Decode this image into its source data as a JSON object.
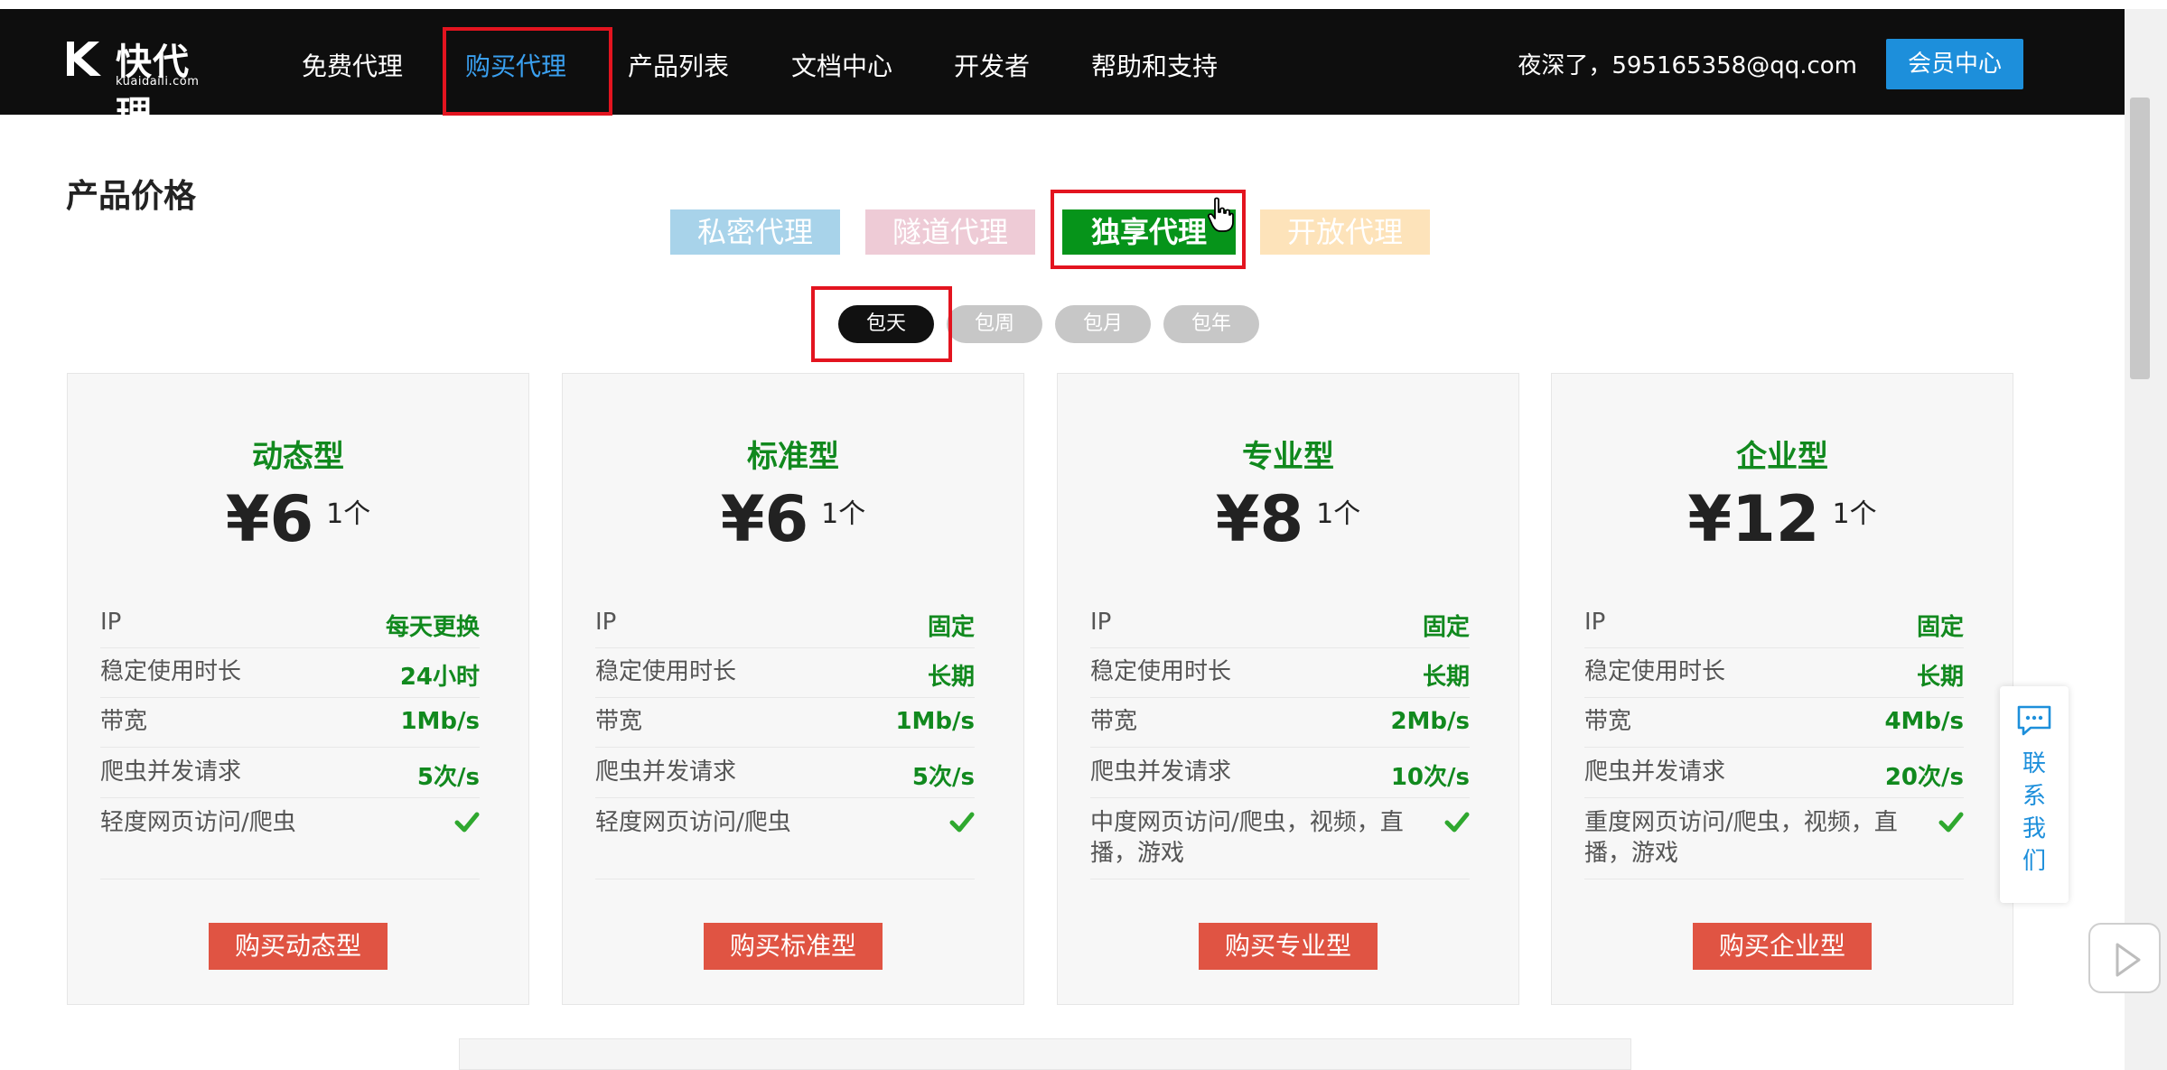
{
  "navbar": {
    "logo_text": "快代理",
    "logo_sub": "kuaidaili.com",
    "items": [
      {
        "label": "免费代理"
      },
      {
        "label": "购买代理"
      },
      {
        "label": "产品列表"
      },
      {
        "label": "文档中心"
      },
      {
        "label": "开发者"
      },
      {
        "label": "帮助和支持"
      }
    ],
    "active_item": "购买代理",
    "greeting": "夜深了，595165358@qq.com",
    "member_button": "会员中心"
  },
  "section_title": "产品价格",
  "product_tabs": [
    {
      "label": "私密代理"
    },
    {
      "label": "隧道代理"
    },
    {
      "label": "独享代理"
    },
    {
      "label": "开放代理"
    }
  ],
  "active_product_tab": "独享代理",
  "periods": [
    {
      "label": "包天"
    },
    {
      "label": "包周"
    },
    {
      "label": "包月"
    },
    {
      "label": "包年"
    }
  ],
  "active_period": "包天",
  "cards": [
    {
      "name": "动态型",
      "price": "¥6",
      "unit": "1个",
      "specs": [
        {
          "label": "IP",
          "value": "每天更换"
        },
        {
          "label": "稳定使用时长",
          "value": "24小时"
        },
        {
          "label": "带宽",
          "value": "1Mb/s"
        },
        {
          "label": "爬虫并发请求",
          "value": "5次/s"
        },
        {
          "label": "轻度网页访问/爬虫",
          "check": true
        }
      ],
      "button": "购买动态型"
    },
    {
      "name": "标准型",
      "price": "¥6",
      "unit": "1个",
      "specs": [
        {
          "label": "IP",
          "value": "固定"
        },
        {
          "label": "稳定使用时长",
          "value": "长期"
        },
        {
          "label": "带宽",
          "value": "1Mb/s"
        },
        {
          "label": "爬虫并发请求",
          "value": "5次/s"
        },
        {
          "label": "轻度网页访问/爬虫",
          "check": true
        }
      ],
      "button": "购买标准型"
    },
    {
      "name": "专业型",
      "price": "¥8",
      "unit": "1个",
      "specs": [
        {
          "label": "IP",
          "value": "固定"
        },
        {
          "label": "稳定使用时长",
          "value": "长期"
        },
        {
          "label": "带宽",
          "value": "2Mb/s"
        },
        {
          "label": "爬虫并发请求",
          "value": "10次/s"
        },
        {
          "label": "中度网页访问/爬虫，视频，直播，游戏",
          "check": true
        }
      ],
      "button": "购买专业型"
    },
    {
      "name": "企业型",
      "price": "¥12",
      "unit": "1个",
      "specs": [
        {
          "label": "IP",
          "value": "固定"
        },
        {
          "label": "稳定使用时长",
          "value": "长期"
        },
        {
          "label": "带宽",
          "value": "4Mb/s"
        },
        {
          "label": "爬虫并发请求",
          "value": "20次/s"
        },
        {
          "label": "重度网页访问/爬虫，视频，直播，游戏",
          "check": true
        }
      ],
      "button": "购买企业型"
    }
  ],
  "contact": {
    "label": "联\n系\n我\n们"
  },
  "icons": {
    "check": "check-icon",
    "contact": "chat-bubble-icon",
    "play": "play-icon"
  },
  "colors": {
    "accent_green": "#11891e",
    "buy_button": "#e05443",
    "member_button": "#1d8fdb",
    "active_nav": "#3aa0f0",
    "annotation_red": "#e3141f"
  }
}
